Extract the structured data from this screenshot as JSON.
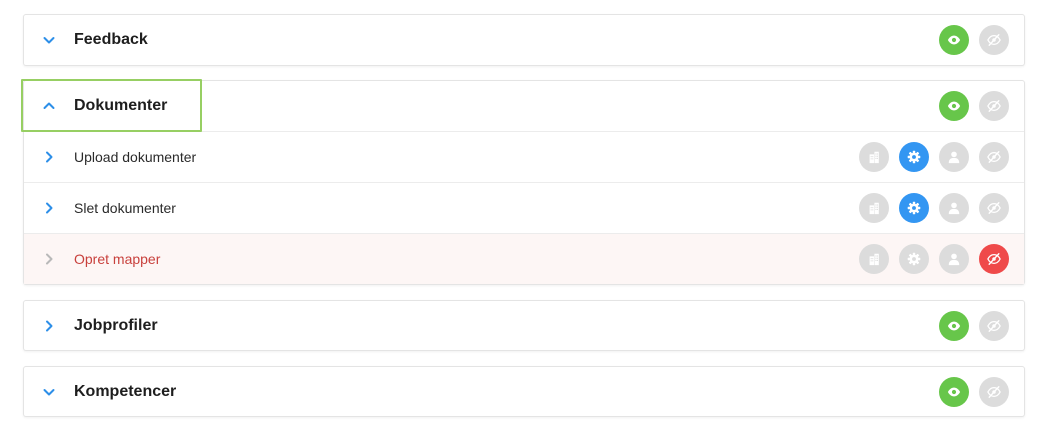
{
  "colors": {
    "chevron": "#2d8fe8",
    "green": "#67c64a",
    "blue": "#3396f2",
    "red": "#ef4a4a",
    "grey": "#dcdcdc",
    "highlight": "#97cf63"
  },
  "sections": {
    "feedback": {
      "title": "Feedback",
      "expanded": false,
      "icons": [
        "eye-icon",
        "eye-slash-icon"
      ]
    },
    "dokumenter": {
      "title": "Dokumenter",
      "expanded": true,
      "icons": [
        "eye-icon",
        "eye-slash-icon"
      ],
      "items": [
        {
          "label": "Upload dokumenter",
          "icons": [
            "building-icon",
            "gear-icon",
            "user-icon",
            "eye-slash-icon"
          ],
          "active": "gear-icon"
        },
        {
          "label": "Slet dokumenter",
          "icons": [
            "building-icon",
            "gear-icon",
            "user-icon",
            "eye-slash-icon"
          ],
          "active": "gear-icon"
        },
        {
          "label": "Opret mapper",
          "icons": [
            "building-icon",
            "gear-icon",
            "user-icon",
            "eye-slash-icon"
          ],
          "active": "eye-slash-icon"
        }
      ]
    },
    "jobprofiler": {
      "title": "Jobprofiler",
      "expanded": false,
      "icons": [
        "eye-icon",
        "eye-slash-icon"
      ]
    },
    "kompetencer": {
      "title": "Kompetencer",
      "expanded": false,
      "icons": [
        "eye-icon",
        "eye-slash-icon"
      ]
    }
  }
}
